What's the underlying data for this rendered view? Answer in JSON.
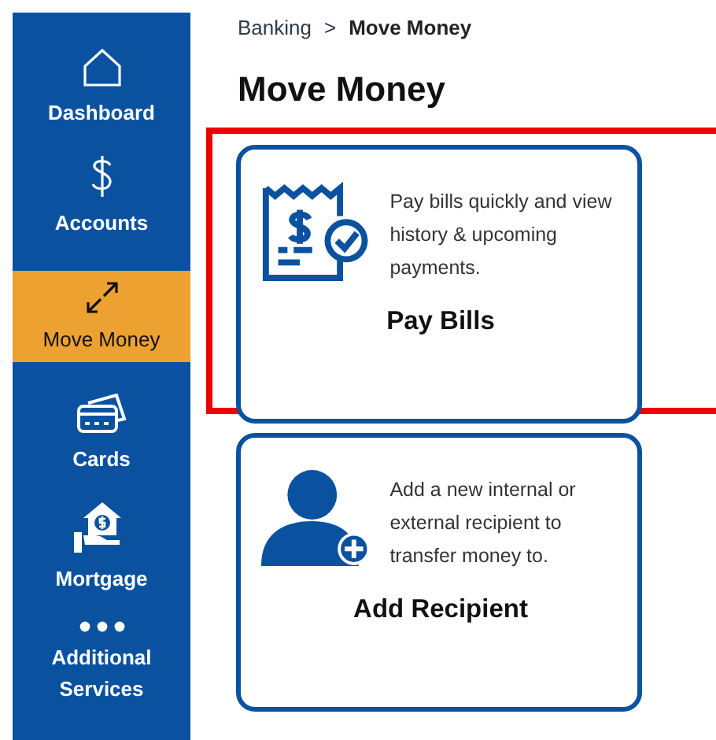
{
  "sidebar": {
    "items": [
      {
        "label": "Dashboard",
        "selected": false
      },
      {
        "label": "Accounts",
        "selected": false
      },
      {
        "label": "Move Money",
        "selected": true
      },
      {
        "label": "Cards",
        "selected": false
      },
      {
        "label": "Mortgage",
        "selected": false
      },
      {
        "label": "Additional Services",
        "selected": false
      }
    ]
  },
  "breadcrumb": [
    {
      "label": "Banking"
    },
    {
      "label": ">"
    },
    {
      "label": "Move Money"
    }
  ],
  "page_title": "Move Money",
  "cards": [
    {
      "title": "Pay Bills",
      "description": "Pay bills quickly and view history & upcoming payments.",
      "highlighted": true
    },
    {
      "title": "Add Recipient",
      "description": "Add a new internal or external recipient to transfer money to.",
      "highlighted": false
    }
  ]
}
